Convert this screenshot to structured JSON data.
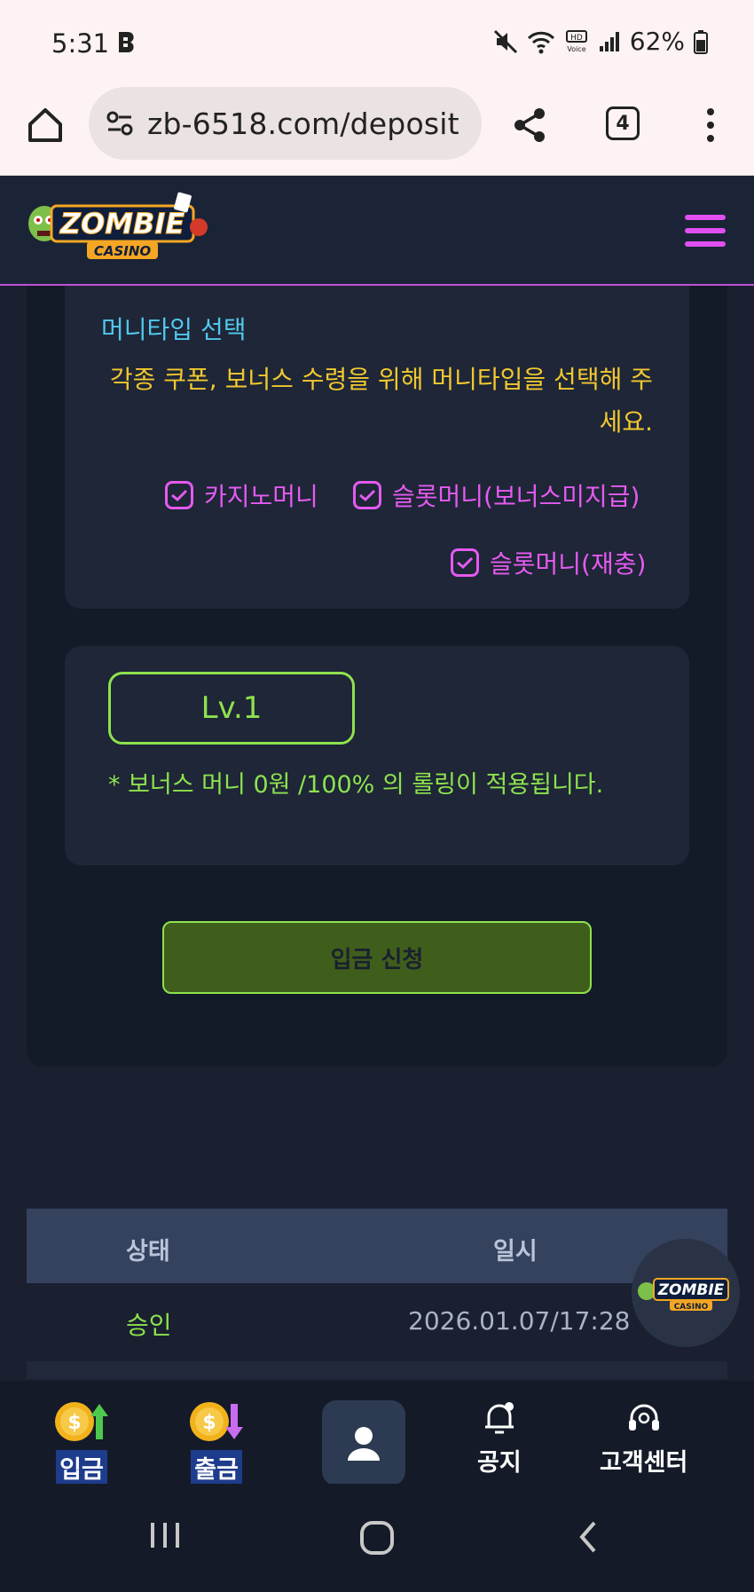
{
  "status_bar": {
    "time": "5:31",
    "battery": "62%",
    "network_label": "HD Voice"
  },
  "browser": {
    "url": "zb-6518.com/deposit",
    "tab_count": "4"
  },
  "site": {
    "logo_text": "ZOMBIE CASINO",
    "accent_color": "#e04ff0"
  },
  "money_type": {
    "title": "머니타입 선택",
    "description": "각종 쿠폰, 보너스 수령을 위해 머니타입을 선택해 주세요.",
    "options": [
      {
        "label": "카지노머니",
        "checked": true
      },
      {
        "label": "슬롯머니(보너스미지급)",
        "checked": true
      },
      {
        "label": "슬롯머니(재충)",
        "checked": true
      }
    ]
  },
  "level": {
    "label": "Lv.1",
    "note": "* 보너스 머니 0원 /100% 의 롤링이 적용됩니다."
  },
  "deposit_button": "입금 신청",
  "history": {
    "columns": [
      "상태",
      "일시"
    ],
    "rows": [
      {
        "status": "승인",
        "datetime": "2026.01.07/17:28"
      }
    ]
  },
  "bottom_nav": {
    "items": [
      "입금",
      "출금",
      "공지",
      "고객센터"
    ]
  }
}
